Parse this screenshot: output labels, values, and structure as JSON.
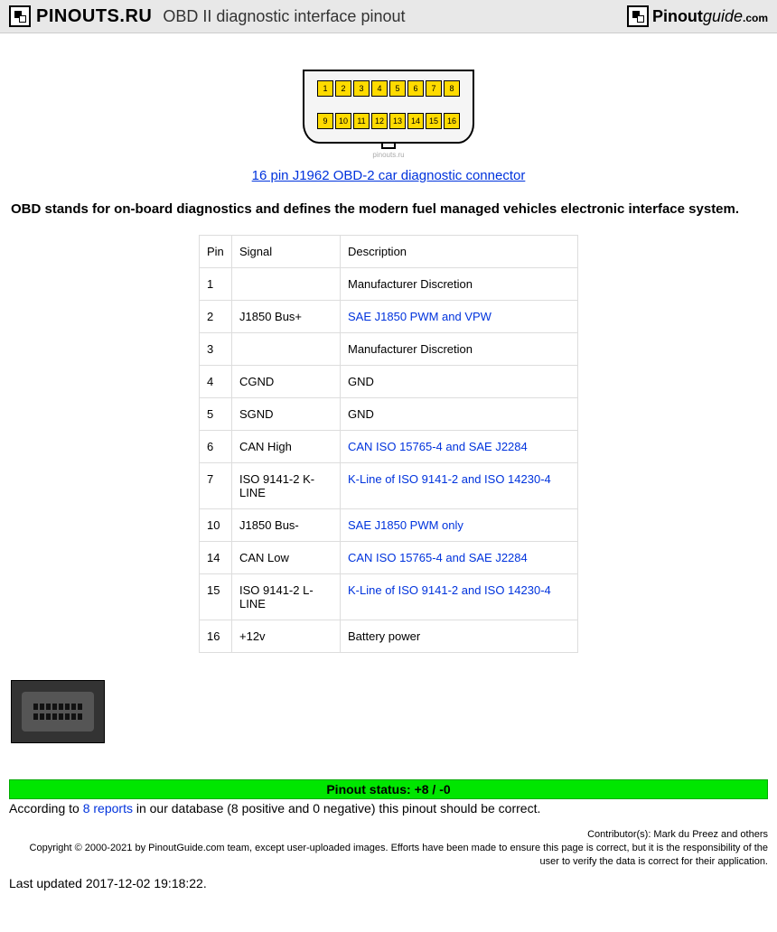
{
  "header": {
    "logo_text": "PINOUTS.RU",
    "title": "OBD II diagnostic interface pinout",
    "right_brand_plain": "Pinout",
    "right_brand_italic": "guide",
    "right_brand_suffix": ".com"
  },
  "diagram": {
    "top_pins": [
      "1",
      "2",
      "3",
      "4",
      "5",
      "6",
      "7",
      "8"
    ],
    "bottom_pins": [
      "9",
      "10",
      "11",
      "12",
      "13",
      "14",
      "15",
      "16"
    ],
    "watermark": "pinouts.ru",
    "link": "16 pin J1962 OBD-2 car diagnostic connector"
  },
  "intro": "OBD stands for on-board diagnostics and defines the modern fuel managed vehicles electronic interface system.",
  "table": {
    "headers": {
      "pin": "Pin",
      "signal": "Signal",
      "desc": "Description"
    },
    "rows": [
      {
        "pin": "1",
        "signal": "",
        "desc": "Manufacturer Discretion",
        "link": false
      },
      {
        "pin": "2",
        "signal": "J1850 Bus+",
        "desc": "SAE J1850 PWM and VPW",
        "link": true
      },
      {
        "pin": "3",
        "signal": "",
        "desc": "Manufacturer Discretion",
        "link": false
      },
      {
        "pin": "4",
        "signal": "CGND",
        "desc": "GND",
        "link": false
      },
      {
        "pin": "5",
        "signal": "SGND",
        "desc": "GND",
        "link": false
      },
      {
        "pin": "6",
        "signal": "CAN High",
        "desc": "CAN ISO 15765-4 and SAE J2284",
        "link": true
      },
      {
        "pin": "7",
        "signal": "ISO 9141-2 K-LINE",
        "desc": "K-Line of ISO 9141-2 and ISO 14230-4",
        "link": true
      },
      {
        "pin": "10",
        "signal": "J1850 Bus-",
        "desc": "SAE J1850 PWM only",
        "link": true
      },
      {
        "pin": "14",
        "signal": "CAN Low",
        "desc": "CAN ISO 15765-4 and SAE J2284",
        "link": true
      },
      {
        "pin": "15",
        "signal": "ISO 9141-2 L-LINE",
        "desc": "K-Line of ISO 9141-2 and ISO 14230-4",
        "link": true
      },
      {
        "pin": "16",
        "signal": "+12v",
        "desc": "Battery power",
        "link": false
      }
    ]
  },
  "status": {
    "bar": "Pinout status: +8 / -0",
    "prefix": "According to ",
    "link": "8 reports",
    "suffix": " in our database (8 positive and 0 negative) this pinout should be correct."
  },
  "footer": {
    "contributors": "Contributor(s): Mark du Preez and others",
    "copyright": "Copyright © 2000-2021 by PinoutGuide.com team, except user-uploaded images. Efforts have been made to ensure this page is correct, but it is the responsibility of the user to verify the data is correct for their application.",
    "last_updated": "Last updated 2017-12-02 19:18:22."
  }
}
